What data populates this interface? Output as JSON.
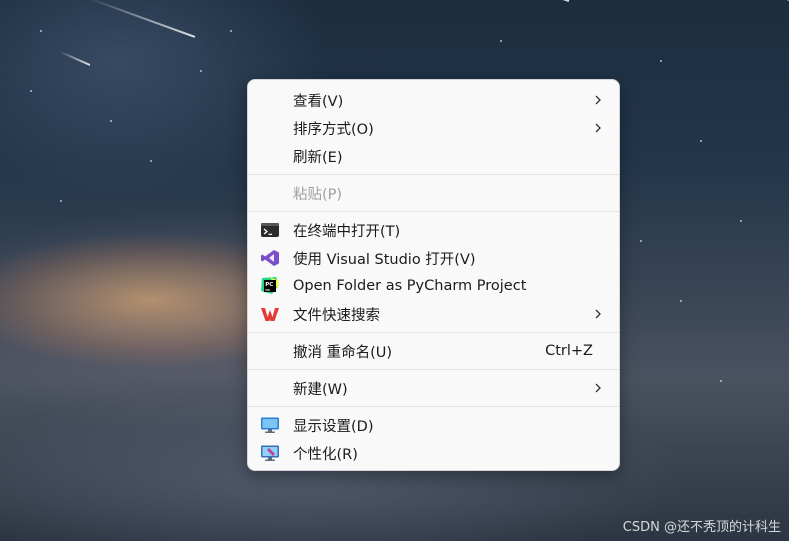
{
  "menu": {
    "view": "查看(V)",
    "sort": "排序方式(O)",
    "refresh": "刷新(E)",
    "paste": "粘贴(P)",
    "terminal": "在终端中打开(T)",
    "vs": "使用 Visual Studio 打开(V)",
    "pycharm": "Open Folder as PyCharm Project",
    "wps_search": "文件快速搜索",
    "undo": "撤消 重命名(U)",
    "undo_shortcut": "Ctrl+Z",
    "new": "新建(W)",
    "display": "显示设置(D)",
    "personalize": "个性化(R)"
  },
  "watermark": "CSDN @还不秃顶的计科生",
  "colors": {
    "menu_bg": "#f9f9f9",
    "text": "#1b1b1b",
    "disabled_text": "#a0a0a0",
    "vs_purple": "#7b4fc9",
    "wps_red": "#e53935",
    "pycharm_green": "#21d789"
  }
}
